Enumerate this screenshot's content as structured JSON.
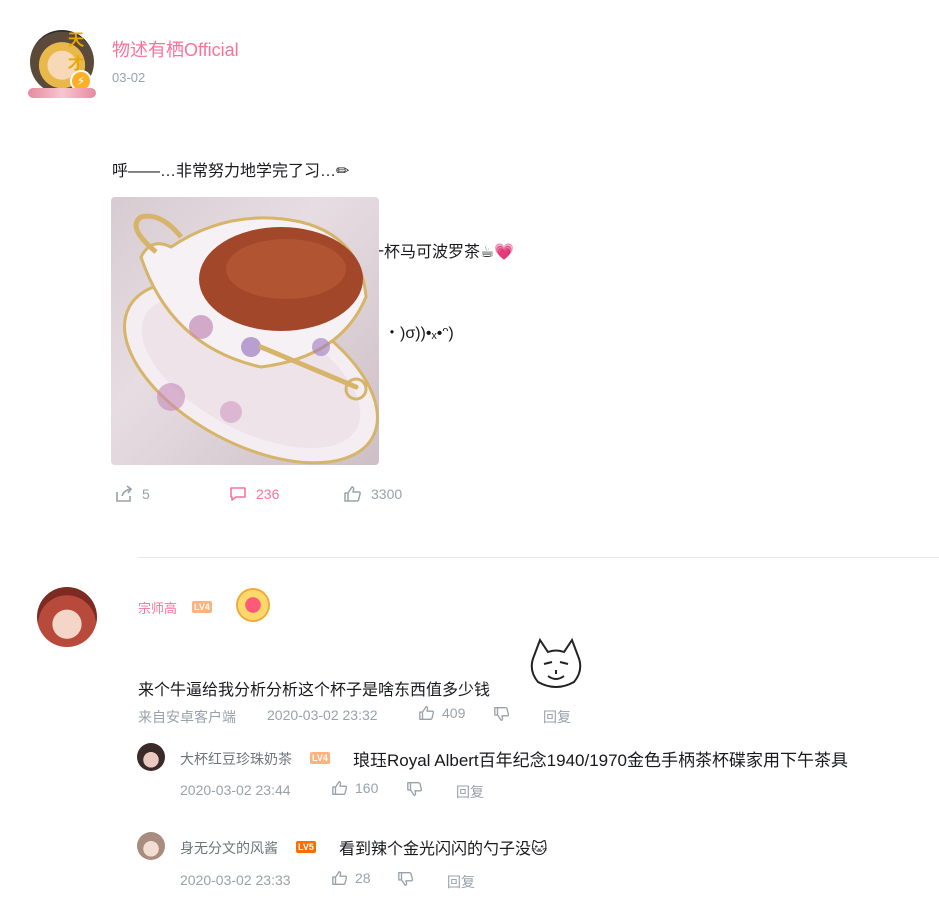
{
  "post": {
    "author": "物述有栖Official",
    "date": "03-02",
    "text_lines": [
      "呼——…非常努力地学完了习…✏",
      "所以就在家里用最大的茶杯泡了满满一杯马可波罗茶☕💗",
      "小兔子们有没有好好犒劳自己呢？ (*・・)σ))•ₓ•ᵔ)"
    ],
    "image_icon": "teacup-photo",
    "actions": {
      "share_count": "5",
      "comment_count": "236",
      "like_count": "3300"
    }
  },
  "comment": {
    "author": "宗师高",
    "level": "LV4",
    "medal_icon": "heart-medal-icon",
    "text": "来个牛逼给我分析分析这个杯子是啥东西值多少钱",
    "sticker_icon": "cat-face-sticker",
    "from": "来自安卓客户端",
    "time": "2020-03-02 23:32",
    "likes": "409",
    "reply_label": "回复"
  },
  "replies": [
    {
      "author": "大杯红豆珍珠奶茶",
      "level": "LV4",
      "text": "琅珏Royal Albert百年纪念1940/1970金色手柄茶杯碟家用下午茶具",
      "time": "2020-03-02 23:44",
      "likes": "160",
      "reply_label": "回复"
    },
    {
      "author": "身无分文的风酱",
      "level": "LV5",
      "text": "看到辣个金光闪闪的勺子没🐱",
      "time": "2020-03-02 23:33",
      "likes": "28",
      "reply_label": "回复"
    }
  ],
  "colors": {
    "accent": "#fb7299",
    "meta": "#99a2aa",
    "text": "#18191c"
  }
}
